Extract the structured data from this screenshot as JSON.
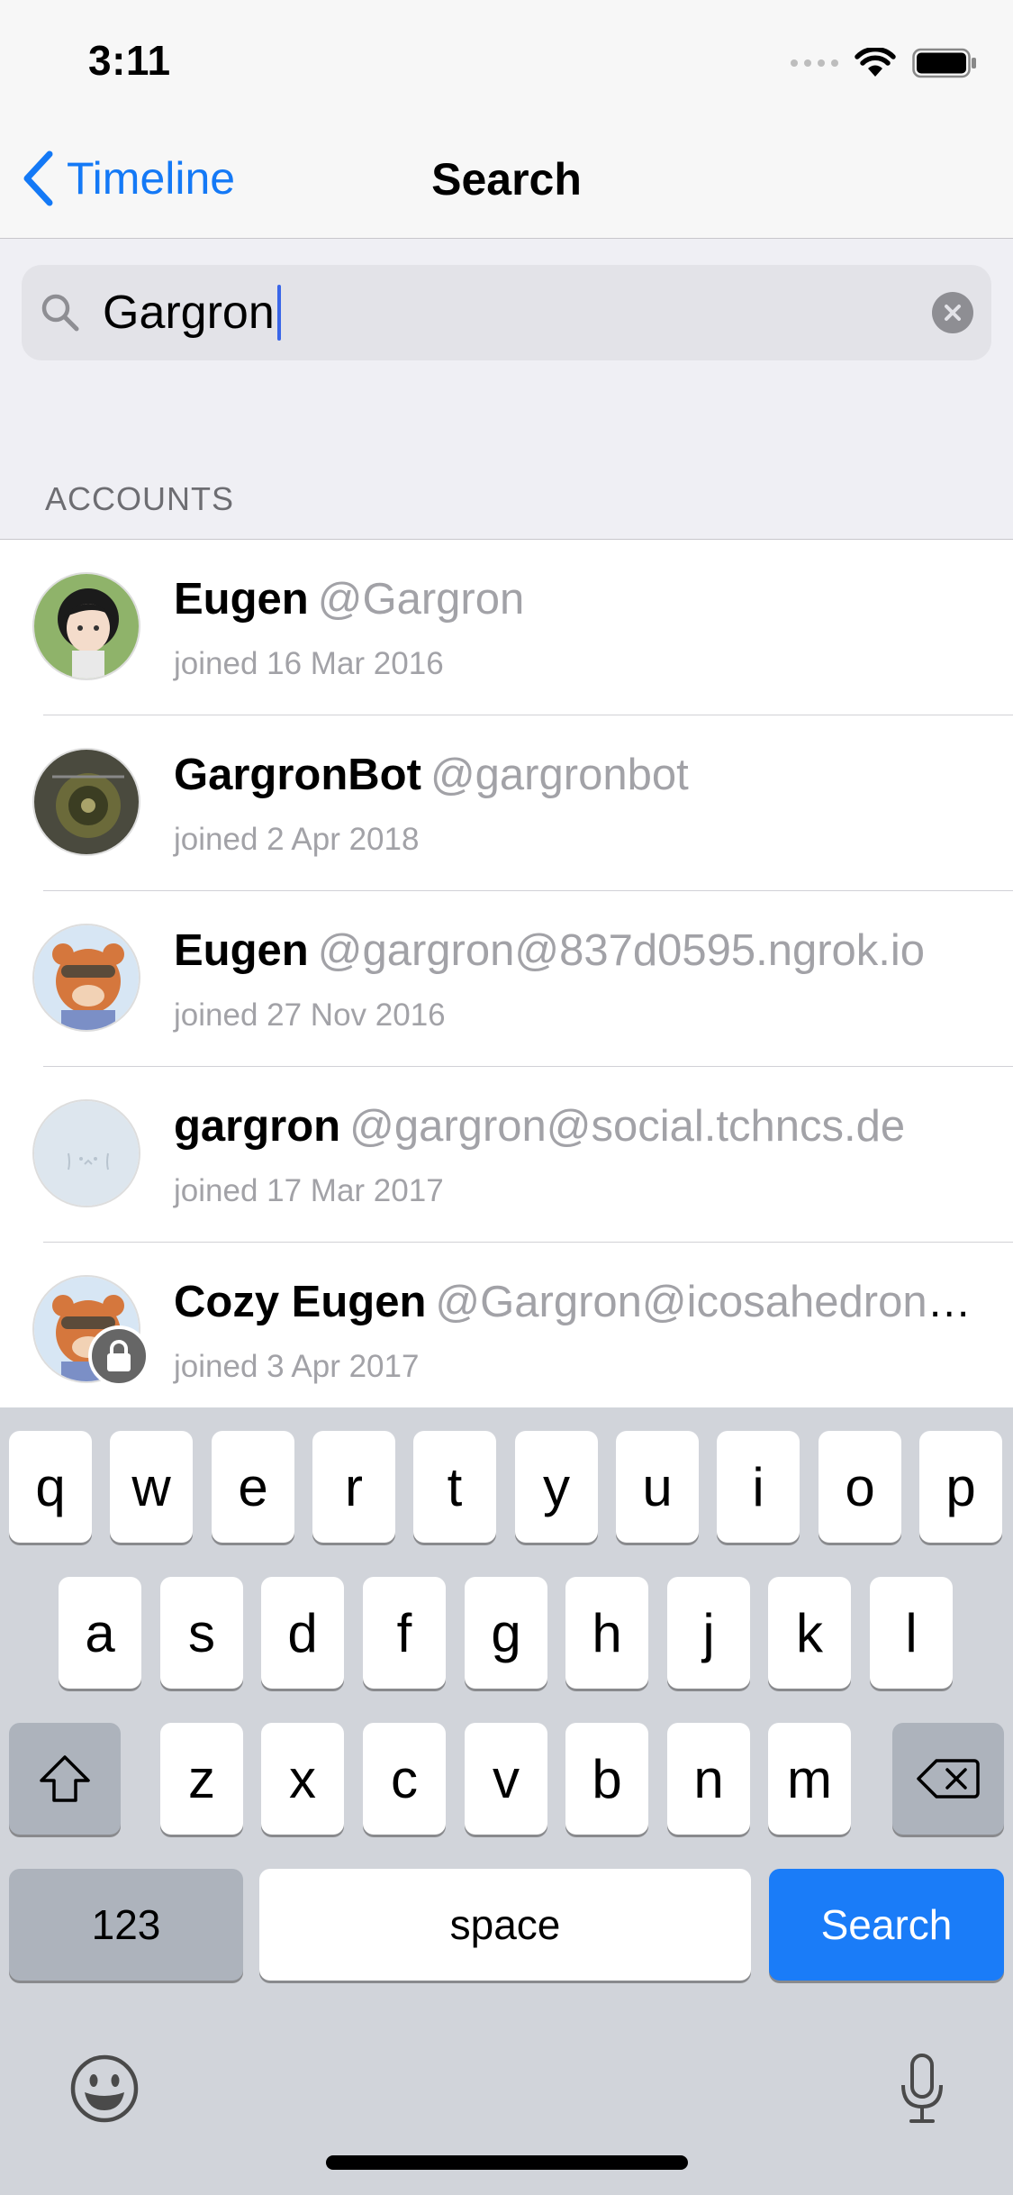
{
  "status_bar": {
    "time": "3:11"
  },
  "nav": {
    "back_label": "Timeline",
    "title": "Search"
  },
  "search": {
    "query": "Gargron"
  },
  "sections": {
    "accounts_header": "ACCOUNTS"
  },
  "accounts": [
    {
      "display_name": "Eugen",
      "handle": "@Gargron",
      "joined": "joined 16 Mar 2016",
      "locked": false
    },
    {
      "display_name": "GargronBot",
      "handle": "@gargronbot",
      "joined": "joined 2 Apr 2018",
      "locked": false
    },
    {
      "display_name": "Eugen",
      "handle": "@gargron@837d0595.ngrok.io",
      "joined": "joined 27 Nov 2016",
      "locked": false
    },
    {
      "display_name": "gargron",
      "handle": "@gargron@social.tchncs.de",
      "joined": "joined 17 Mar 2017",
      "locked": false
    },
    {
      "display_name": "Cozy Eugen",
      "handle": "@Gargron@icosahedron.website",
      "joined": "joined 3 Apr 2017",
      "locked": true
    }
  ],
  "keyboard": {
    "row1": [
      "q",
      "w",
      "e",
      "r",
      "t",
      "y",
      "u",
      "i",
      "o",
      "p"
    ],
    "row2": [
      "a",
      "s",
      "d",
      "f",
      "g",
      "h",
      "j",
      "k",
      "l"
    ],
    "row3": [
      "z",
      "x",
      "c",
      "v",
      "b",
      "n",
      "m"
    ],
    "numbers_label": "123",
    "space_label": "space",
    "return_label": "Search"
  },
  "colors": {
    "accent": "#1479f6",
    "return_key": "#1a7cf8"
  }
}
